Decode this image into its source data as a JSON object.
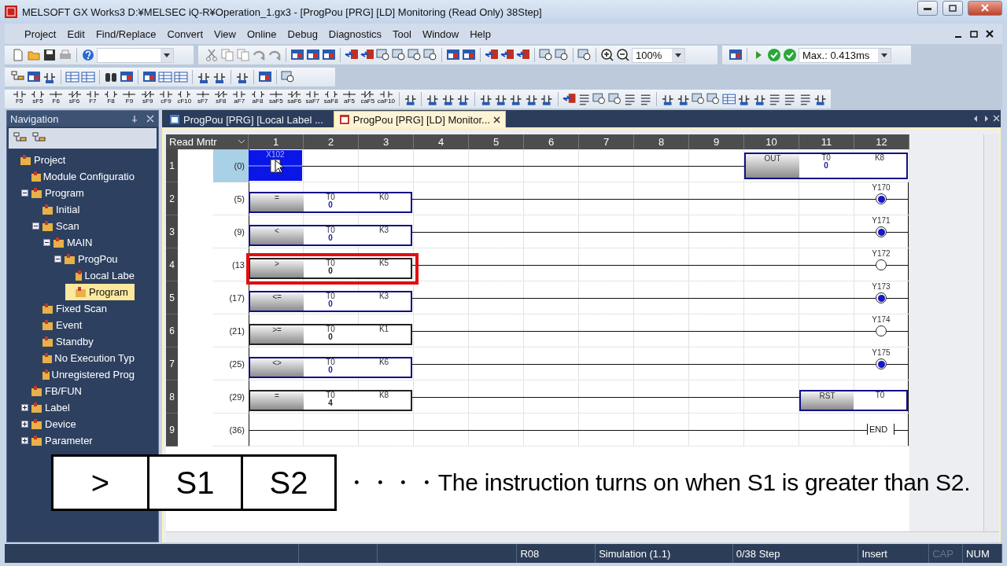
{
  "window": {
    "title": "MELSOFT GX Works3 D:¥MELSEC iQ-R¥Operation_1.gx3 - [ProgPou [PRG] [LD] Monitoring (Read Only) 38Step]"
  },
  "menu": [
    "Project",
    "Edit",
    "Find/Replace",
    "Convert",
    "View",
    "Online",
    "Debug",
    "Diagnostics",
    "Tool",
    "Window",
    "Help"
  ],
  "toolbar": {
    "zoom": "100%",
    "scan_time": "Max.: 0.413ms"
  },
  "function_keys": [
    "F5",
    "sF5",
    "F6",
    "sF6",
    "F7",
    "F8",
    "F9",
    "sF9",
    "cF9",
    "cF10",
    "sF7",
    "sF8",
    "aF7",
    "aF8",
    "saF5",
    "saF6",
    "saF7",
    "saF8",
    "aF5",
    "caF5",
    "caF10"
  ],
  "navigation": {
    "title": "Navigation",
    "tree": [
      {
        "label": "Project",
        "selected": false,
        "children": [
          {
            "label": "Module Configuratio",
            "selected": false
          },
          {
            "label": "Program",
            "selected": false,
            "expanded": true,
            "children": [
              {
                "label": "Initial",
                "selected": false
              },
              {
                "label": "Scan",
                "selected": false,
                "expanded": true,
                "children": [
                  {
                    "label": "MAIN",
                    "selected": false,
                    "expanded": true,
                    "children": [
                      {
                        "label": "ProgPou",
                        "selected": false,
                        "expanded": true,
                        "children": [
                          {
                            "label": "Local Labe",
                            "selected": false
                          },
                          {
                            "label": "Program",
                            "selected": true
                          }
                        ]
                      }
                    ]
                  }
                ]
              },
              {
                "label": "Fixed Scan",
                "selected": false
              },
              {
                "label": "Event",
                "selected": false
              },
              {
                "label": "Standby",
                "selected": false
              },
              {
                "label": "No Execution Typ",
                "selected": false
              },
              {
                "label": "Unregistered Prog",
                "selected": false
              }
            ]
          },
          {
            "label": "FB/FUN",
            "selected": false
          },
          {
            "label": "Label",
            "selected": false,
            "expanded": false
          },
          {
            "label": "Device",
            "selected": false,
            "expanded": false
          },
          {
            "label": "Parameter",
            "selected": false,
            "expanded": false
          }
        ]
      }
    ]
  },
  "tabs": [
    {
      "label": "ProgPou [PRG] [Local Label ...",
      "selected": false
    },
    {
      "label": "ProgPou [PRG] [LD] Monitor...",
      "selected": true
    }
  ],
  "ladder": {
    "mode": "Read Mntr",
    "columns": [
      "1",
      "2",
      "3",
      "4",
      "5",
      "6",
      "7",
      "8",
      "9",
      "10",
      "11",
      "12"
    ],
    "rungs": [
      {
        "kind": "contact_out",
        "row": "1",
        "step": "(0)",
        "selected": true,
        "device": "X102",
        "on": true,
        "instruction": "OUT",
        "operand": "T0",
        "value": "0",
        "setting": "K8",
        "active": true
      },
      {
        "kind": "compare_coil",
        "row": "2",
        "step": "(5)",
        "selected": false,
        "op": "=",
        "s1": "T0",
        "value": "0",
        "s2": "K0",
        "active": true,
        "coil": "Y170",
        "on": true
      },
      {
        "kind": "compare_coil",
        "row": "3",
        "step": "(9)",
        "selected": false,
        "op": "<",
        "s1": "T0",
        "value": "0",
        "s2": "K3",
        "active": true,
        "coil": "Y171",
        "on": true
      },
      {
        "kind": "compare_coil",
        "row": "4",
        "step": "(13",
        "selected": false,
        "op": ">",
        "s1": "T0",
        "value": "0",
        "s2": "K5",
        "active": false,
        "coil": "Y172",
        "on": false,
        "highlighted": true
      },
      {
        "kind": "compare_coil",
        "row": "5",
        "step": "(17)",
        "selected": false,
        "op": "<=",
        "s1": "T0",
        "value": "0",
        "s2": "K3",
        "active": true,
        "coil": "Y173",
        "on": true
      },
      {
        "kind": "compare_coil",
        "row": "6",
        "step": "(21)",
        "selected": false,
        "op": ">=",
        "s1": "T0",
        "value": "0",
        "s2": "K1",
        "active": false,
        "coil": "Y174",
        "on": false
      },
      {
        "kind": "compare_coil",
        "row": "7",
        "step": "(25)",
        "selected": false,
        "op": "<>",
        "s1": "T0",
        "value": "0",
        "s2": "K6",
        "active": true,
        "coil": "Y175",
        "on": true
      },
      {
        "kind": "compare_reset",
        "row": "8",
        "step": "(29)",
        "selected": false,
        "op": "=",
        "s1": "T0",
        "value": "4",
        "s2": "K8",
        "active": false,
        "instruction": "RST",
        "operand": "T0",
        "reset_active": true
      },
      {
        "kind": "end",
        "row": "9",
        "step": "(36)",
        "selected": false,
        "label": "END"
      }
    ]
  },
  "caption": {
    "cells": [
      ">",
      "S1",
      "S2"
    ],
    "text": "・・・・The instruction turns on when S1 is greater than S2."
  },
  "status_bar": [
    {
      "text": "R08",
      "disabled": false
    },
    {
      "text": "Simulation (1.1)",
      "disabled": false
    },
    {
      "text": "0/38 Step",
      "disabled": false
    },
    {
      "text": "Insert",
      "disabled": false
    },
    {
      "text": "CAP",
      "disabled": true
    },
    {
      "text": "NUM",
      "disabled": false
    }
  ]
}
